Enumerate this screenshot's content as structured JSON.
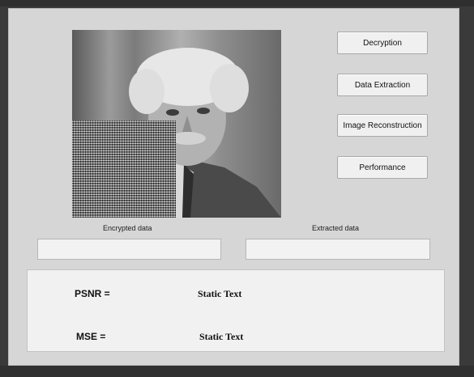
{
  "buttons": {
    "decryption": "Decryption",
    "data_extraction": "Data Extraction",
    "image_reconstruction": "Image Reconstruction",
    "performance": "Performance"
  },
  "labels": {
    "encrypted": "Encrypted data",
    "extracted": "Extracted data"
  },
  "fields": {
    "encrypted_value": "",
    "extracted_value": ""
  },
  "performance": {
    "psnr_label": "PSNR =",
    "psnr_value": "Static Text",
    "mse_label": "MSE =",
    "mse_value": "Static Text"
  }
}
